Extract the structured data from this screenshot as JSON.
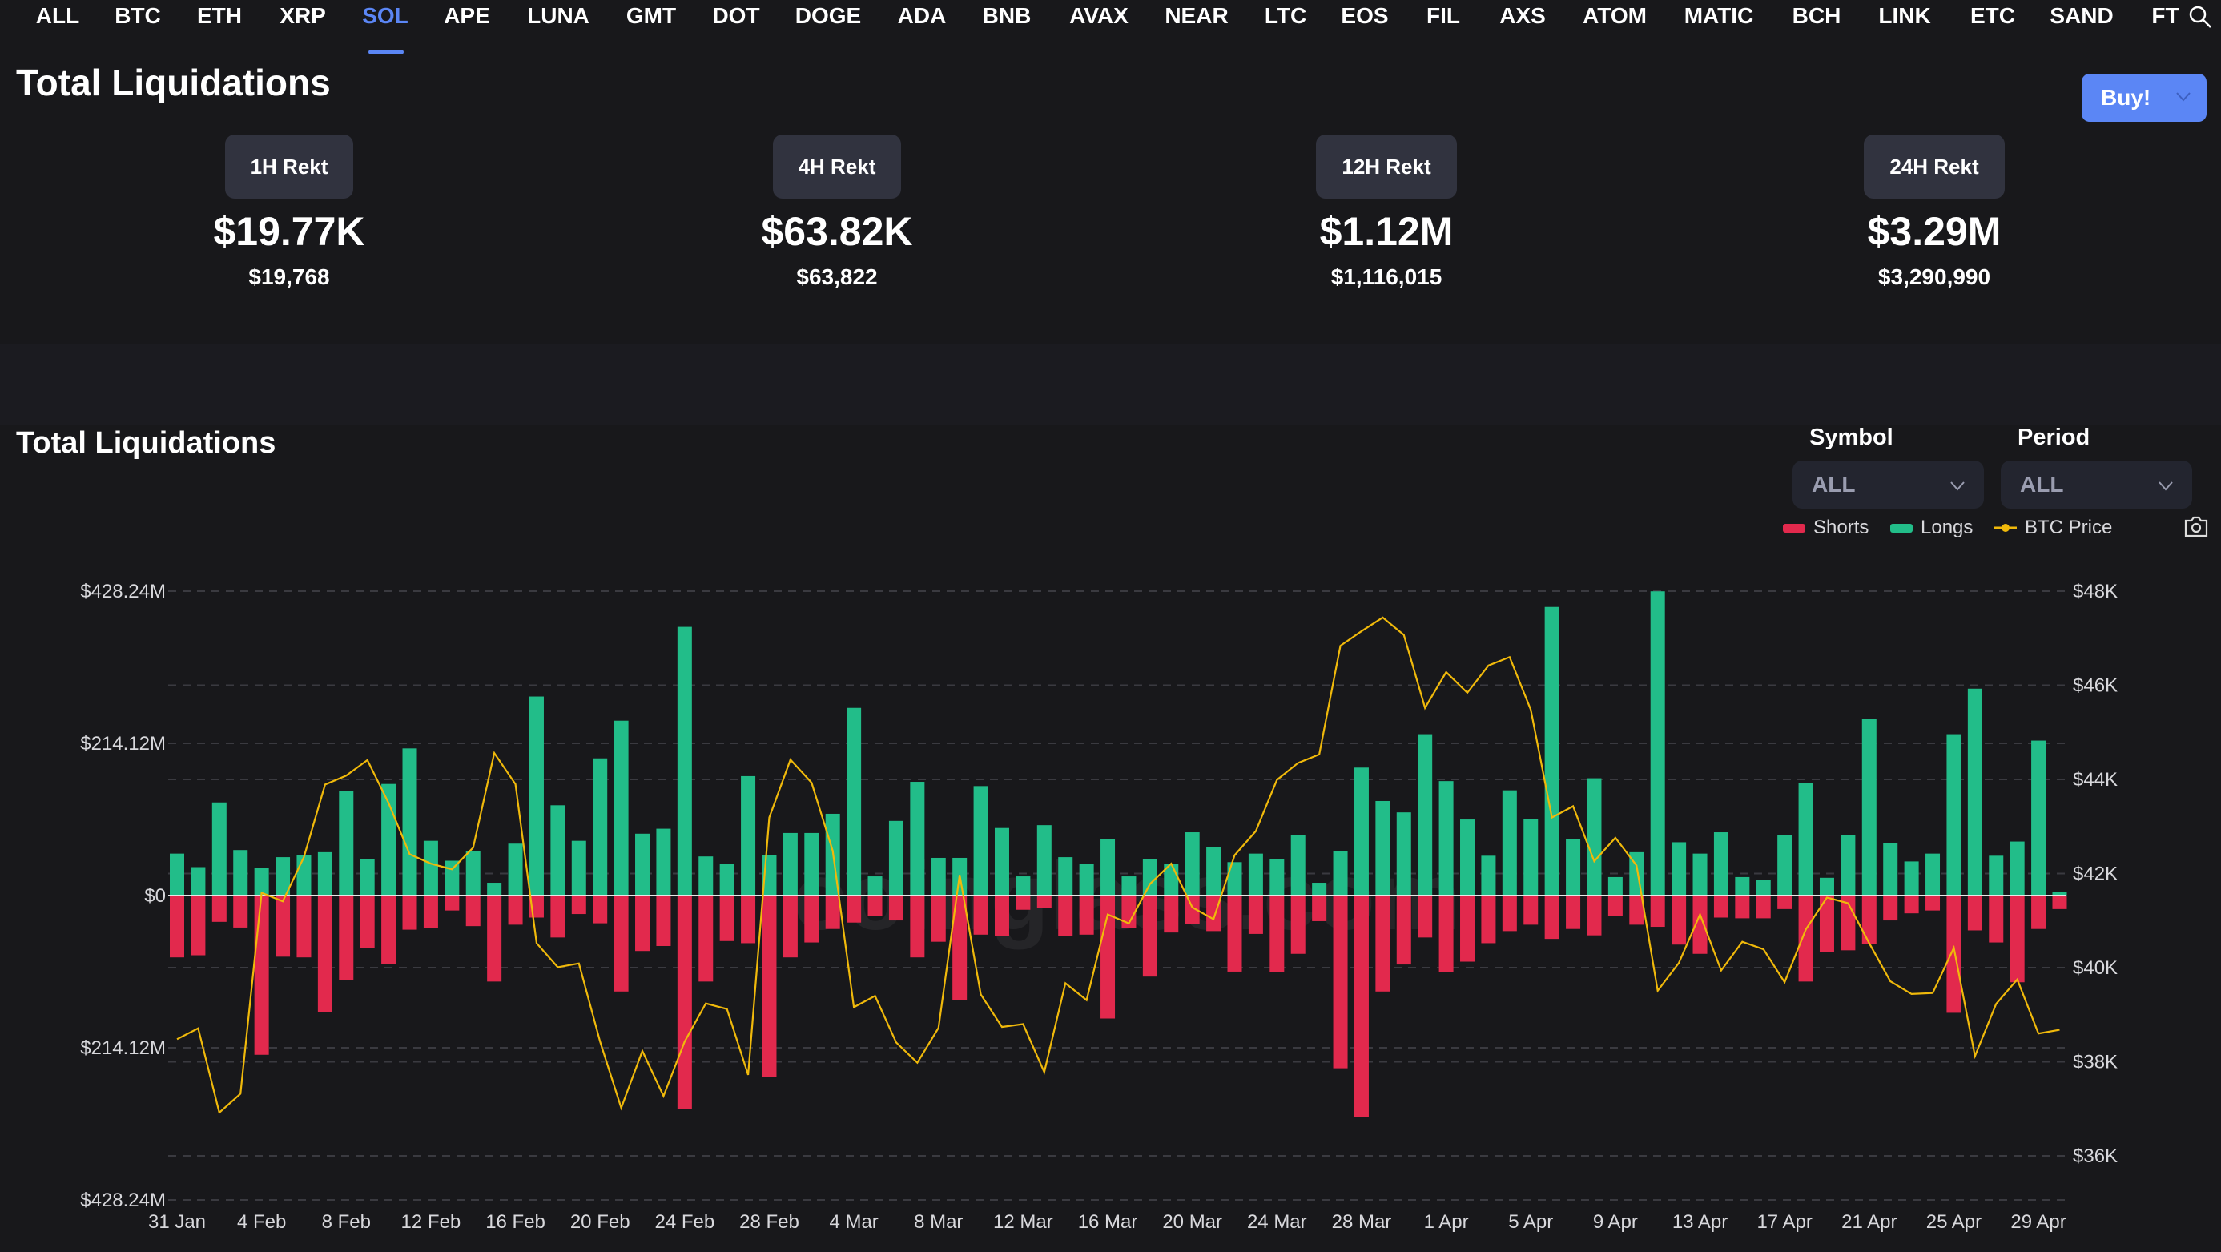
{
  "tabs": [
    "ALL",
    "BTC",
    "ETH",
    "XRP",
    "SOL",
    "APE",
    "LUNA",
    "GMT",
    "DOT",
    "DOGE",
    "ADA",
    "BNB",
    "AVAX",
    "NEAR",
    "LTC",
    "EOS",
    "FIL",
    "AXS",
    "ATOM",
    "MATIC",
    "BCH",
    "LINK",
    "ETC",
    "SAND",
    "FTT"
  ],
  "active_tab": "SOL",
  "header": {
    "title": "Total Liquidations",
    "buy_label": "Buy!"
  },
  "cards": [
    {
      "label": "1H Rekt",
      "value": "$19.77K",
      "exact": "$19,768"
    },
    {
      "label": "4H Rekt",
      "value": "$63.82K",
      "exact": "$63,822"
    },
    {
      "label": "12H Rekt",
      "value": "$1.12M",
      "exact": "$1,116,015"
    },
    {
      "label": "24H Rekt",
      "value": "$3.29M",
      "exact": "$3,290,990"
    }
  ],
  "chart_section": {
    "title": "Total Liquidations",
    "symbol_label": "Symbol",
    "symbol_value": "ALL",
    "period_label": "Period",
    "period_value": "ALL",
    "legend": {
      "shorts": "Shorts",
      "longs": "Longs",
      "btc": "BTC Price"
    },
    "watermark": "coinglass.com"
  },
  "colors": {
    "longs": "#22bd89",
    "shorts": "#e2294d",
    "btc": "#f0b90b",
    "accent": "#5b86f5"
  },
  "chart_data": {
    "type": "bar",
    "left_ticks": [
      "$428.24M",
      "$214.12M",
      "$0",
      "$214.12M",
      "$428.24M"
    ],
    "right_ticks": [
      "$48K",
      "$46K",
      "$44K",
      "$42K",
      "$40K",
      "$38K",
      "$36K"
    ],
    "ylim_left_millions": [
      -428.24,
      428.24
    ],
    "ylim_right_thousands": [
      36,
      48
    ],
    "grid": true,
    "legend_position": "top-right",
    "x_ticks": [
      "31 Jan",
      "4 Feb",
      "8 Feb",
      "12 Feb",
      "16 Feb",
      "20 Feb",
      "24 Feb",
      "28 Feb",
      "4 Mar",
      "8 Mar",
      "12 Mar",
      "16 Mar",
      "20 Mar",
      "24 Mar",
      "28 Mar",
      "1 Apr",
      "5 Apr",
      "9 Apr",
      "13 Apr",
      "17 Apr",
      "21 Apr",
      "25 Apr",
      "29 Apr"
    ],
    "categories": [
      "31 Jan",
      "1 Feb",
      "2 Feb",
      "3 Feb",
      "4 Feb",
      "5 Feb",
      "6 Feb",
      "7 Feb",
      "8 Feb",
      "9 Feb",
      "10 Feb",
      "11 Feb",
      "12 Feb",
      "13 Feb",
      "14 Feb",
      "15 Feb",
      "16 Feb",
      "17 Feb",
      "18 Feb",
      "19 Feb",
      "20 Feb",
      "21 Feb",
      "22 Feb",
      "23 Feb",
      "24 Feb",
      "25 Feb",
      "26 Feb",
      "27 Feb",
      "28 Feb",
      "1 Mar",
      "2 Mar",
      "3 Mar",
      "4 Mar",
      "5 Mar",
      "6 Mar",
      "7 Mar",
      "8 Mar",
      "9 Mar",
      "10 Mar",
      "11 Mar",
      "12 Mar",
      "13 Mar",
      "14 Mar",
      "15 Mar",
      "16 Mar",
      "17 Mar",
      "18 Mar",
      "19 Mar",
      "20 Mar",
      "21 Mar",
      "22 Mar",
      "23 Mar",
      "24 Mar",
      "25 Mar",
      "26 Mar",
      "27 Mar",
      "28 Mar",
      "29 Mar",
      "30 Mar",
      "31 Mar",
      "1 Apr",
      "2 Apr",
      "3 Apr",
      "4 Apr",
      "5 Apr",
      "6 Apr",
      "7 Apr",
      "8 Apr",
      "9 Apr",
      "10 Apr",
      "11 Apr",
      "12 Apr",
      "13 Apr",
      "14 Apr",
      "15 Apr",
      "16 Apr",
      "17 Apr",
      "18 Apr",
      "19 Apr",
      "20 Apr",
      "21 Apr",
      "22 Apr",
      "23 Apr",
      "24 Apr",
      "25 Apr",
      "26 Apr",
      "27 Apr",
      "28 Apr",
      "29 Apr",
      "30 Apr"
    ],
    "series": [
      {
        "name": "Longs",
        "unit": "M USD",
        "values": [
          59,
          40,
          131,
          64,
          39,
          54,
          57,
          61,
          147,
          51,
          157,
          207,
          77,
          49,
          62,
          18,
          73,
          280,
          127,
          77,
          193,
          246,
          87,
          94,
          378,
          55,
          45,
          168,
          57,
          88,
          88,
          115,
          264,
          27,
          105,
          160,
          53,
          53,
          154,
          95,
          27,
          99,
          54,
          44,
          80,
          27,
          51,
          44,
          89,
          68,
          47,
          59,
          51,
          85,
          18,
          63,
          180,
          133,
          117,
          227,
          161,
          107,
          56,
          148,
          108,
          406,
          80,
          165,
          26,
          61,
          428,
          75,
          59,
          89,
          26,
          22,
          85,
          158,
          25,
          85,
          249,
          74,
          48,
          59,
          227,
          291,
          56,
          76,
          218,
          5
        ]
      },
      {
        "name": "Shorts",
        "unit": "M USD",
        "values": [
          87,
          84,
          37,
          45,
          224,
          86,
          87,
          164,
          119,
          74,
          96,
          48,
          46,
          21,
          43,
          121,
          41,
          31,
          59,
          26,
          39,
          135,
          78,
          71,
          300,
          121,
          64,
          67,
          255,
          87,
          66,
          47,
          38,
          29,
          35,
          87,
          65,
          147,
          55,
          57,
          20,
          18,
          57,
          55,
          173,
          46,
          114,
          52,
          40,
          50,
          107,
          54,
          108,
          82,
          36,
          243,
          312,
          135,
          97,
          59,
          108,
          93,
          67,
          50,
          41,
          61,
          47,
          56,
          29,
          41,
          44,
          69,
          82,
          31,
          32,
          32,
          19,
          121,
          80,
          77,
          68,
          35,
          25,
          21,
          165,
          49,
          66,
          122,
          47,
          19
        ]
      },
      {
        "name": "BTC Price",
        "unit": "K USD",
        "values": [
          38.48,
          38.71,
          36.92,
          37.32,
          41.59,
          41.41,
          42.35,
          43.89,
          44.08,
          44.41,
          43.5,
          42.41,
          42.21,
          42.09,
          42.55,
          44.56,
          43.9,
          40.52,
          40.01,
          40.09,
          38.43,
          37.02,
          38.23,
          37.27,
          38.43,
          39.24,
          39.12,
          37.72,
          43.19,
          44.42,
          43.93,
          42.48,
          39.16,
          39.4,
          38.41,
          37.98,
          38.72,
          41.97,
          39.43,
          38.74,
          38.8,
          37.78,
          39.67,
          39.31,
          41.13,
          40.94,
          41.78,
          42.21,
          41.28,
          41.03,
          42.39,
          42.9,
          43.99,
          44.35,
          44.53,
          46.84,
          47.15,
          47.44,
          47.07,
          45.52,
          46.28,
          45.84,
          46.42,
          46.6,
          45.48,
          43.19,
          43.43,
          42.26,
          42.76,
          42.17,
          39.51,
          40.1,
          41.13,
          39.94,
          40.55,
          40.39,
          39.69,
          40.81,
          41.49,
          41.37,
          40.52,
          39.71,
          39.44,
          39.46,
          40.42,
          38.12,
          39.23,
          39.75,
          38.6,
          38.68
        ]
      }
    ]
  }
}
